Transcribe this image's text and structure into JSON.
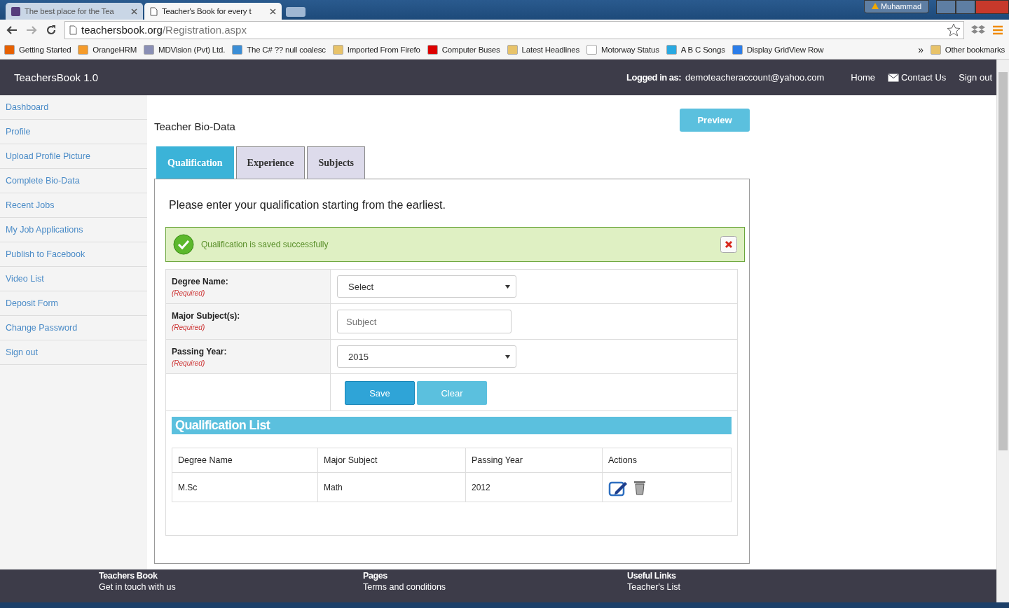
{
  "browser": {
    "tabs": [
      {
        "title": "The best place for the Tea",
        "selected": false
      },
      {
        "title": "Teacher's Book for every t",
        "selected": true
      }
    ],
    "profile": "Muhammad",
    "address": {
      "host": "teachersbook.org",
      "path": "/Registration.aspx"
    },
    "bookmarks": [
      "Getting Started",
      "OrangeHRM",
      "MDVision (Pvt) Ltd.",
      "The C# ?? null coalesc",
      "Imported From Firefo",
      "Computer Buses",
      "Latest Headlines",
      "Motorway Status",
      "A B C Songs",
      "Display GridView Row"
    ],
    "overflow": "»",
    "other_bookmarks": "Other bookmarks"
  },
  "header": {
    "brand": "TeachersBook 1.0",
    "logged_in_label": "Logged in as:",
    "email": "demoteacheraccount@yahoo.com",
    "links": [
      "Home",
      "Contact Us",
      "Sign out"
    ]
  },
  "sidebar": {
    "items": [
      {
        "label": "Dashboard"
      },
      {
        "label": "Profile"
      },
      {
        "label": "Upload Profile Picture"
      },
      {
        "label": "Complete Bio-Data"
      },
      {
        "label": "Recent Jobs"
      },
      {
        "label": "My Job Applications"
      },
      {
        "label": "Publish to Facebook"
      },
      {
        "label": "Video List"
      },
      {
        "label": "Deposit Form"
      },
      {
        "label": "Change Password"
      },
      {
        "label": "Sign out"
      }
    ]
  },
  "page": {
    "title": "Teacher Bio-Data",
    "preview_button": "Preview",
    "tabs": [
      {
        "label": "Qualification",
        "selected": true
      },
      {
        "label": "Experience",
        "selected": false
      },
      {
        "label": "Subjects",
        "selected": false
      }
    ],
    "instruction": "Please enter your qualification starting from the earliest.",
    "alert": {
      "message": "Qualification is saved successfully"
    },
    "form": [
      {
        "label": "Degree Name:",
        "required": "(Required)",
        "kind": "select",
        "value": "Select"
      },
      {
        "label": "Major Subject(s):",
        "required": "(Required)",
        "kind": "text",
        "placeholder": "Subject"
      },
      {
        "label": "Passing Year:",
        "required": "(Required)",
        "kind": "select",
        "value": "2015"
      }
    ],
    "buttons": [
      "Save",
      "Clear"
    ],
    "list": {
      "title": "Qualification List",
      "columns": [
        "Degree Name",
        "Major Subject",
        "Passing Year",
        "Actions"
      ],
      "rows": [
        [
          "M.Sc",
          "Math",
          "2012"
        ]
      ]
    }
  },
  "footer": {
    "columns": [
      {
        "title": "Teachers Book",
        "link": "Get in touch with us"
      },
      {
        "title": "Pages",
        "link": "Terms and conditions"
      },
      {
        "title": "Useful Links",
        "link": "Teacher's List"
      }
    ]
  }
}
